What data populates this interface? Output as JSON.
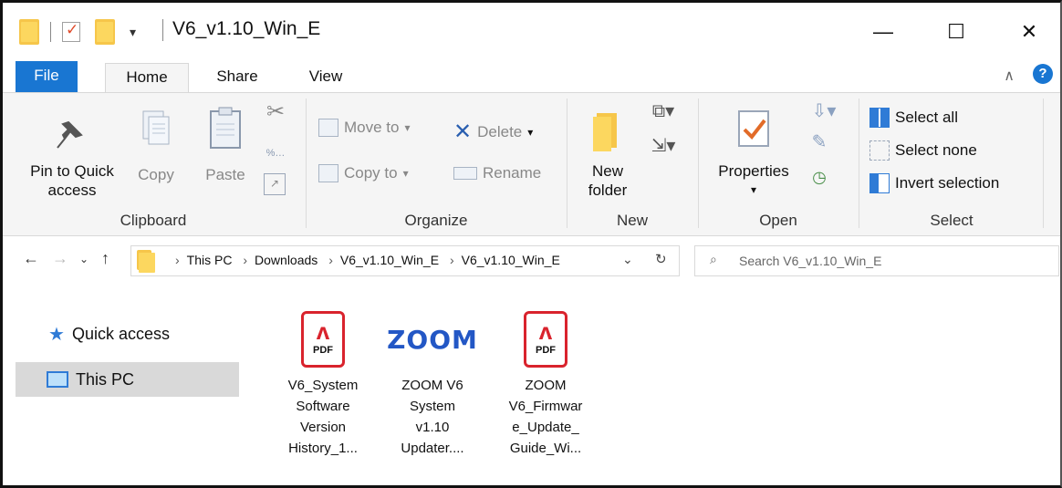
{
  "window": {
    "title": "V6_v1.10_Win_E",
    "controls": {
      "minimize": "—",
      "maximize": "☐",
      "close": "✕"
    }
  },
  "tabs": [
    {
      "label": "File"
    },
    {
      "label": "Home"
    },
    {
      "label": "Share"
    },
    {
      "label": "View"
    }
  ],
  "ribbon": {
    "clipboard": {
      "label": "Clipboard",
      "pin_label_1": "Pin to Quick",
      "pin_label_2": "access",
      "copy": "Copy",
      "paste": "Paste"
    },
    "organize": {
      "label": "Organize",
      "move_to": "Move to",
      "copy_to": "Copy to",
      "delete": "Delete",
      "rename": "Rename"
    },
    "new": {
      "label": "New",
      "new_folder_1": "New",
      "new_folder_2": "folder"
    },
    "open": {
      "label": "Open",
      "properties": "Properties"
    },
    "select": {
      "label": "Select",
      "select_all": "Select all",
      "select_none": "Select none",
      "invert": "Invert selection"
    }
  },
  "address": {
    "crumbs": [
      "This PC",
      "Downloads",
      "V6_v1.10_Win_E",
      "V6_v1.10_Win_E"
    ],
    "search_placeholder": "Search V6_v1.10_Win_E"
  },
  "nav": {
    "quick_access": "Quick access",
    "this_pc": "This PC"
  },
  "files": [
    {
      "icon": "pdf-icon",
      "lines": [
        "V6_System",
        "Software",
        "Version",
        "History_1..."
      ]
    },
    {
      "icon": "zoom-app-icon",
      "logo": "ZOOM",
      "lines": [
        "ZOOM V6",
        "System",
        "v1.10",
        "Updater...."
      ]
    },
    {
      "icon": "pdf-icon",
      "lines": [
        "ZOOM",
        "V6_Firmwar",
        "e_Update_",
        "Guide_Wi..."
      ]
    }
  ],
  "pdf_badge": "PDF",
  "colors": {
    "accent": "#1976d2",
    "folder": "#f6c64a",
    "pdf_red": "#d9232d"
  }
}
